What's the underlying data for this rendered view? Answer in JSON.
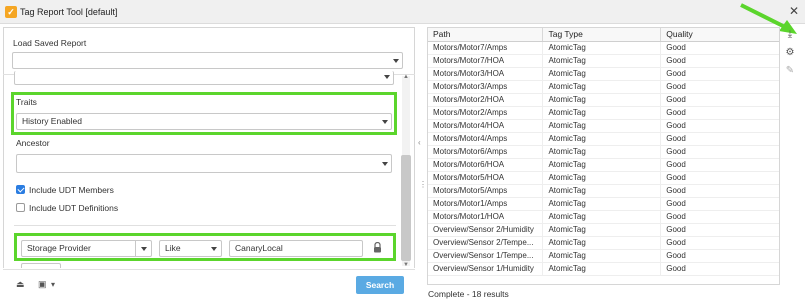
{
  "window": {
    "title": "Tag Report Tool [default]",
    "icon": "check-icon",
    "close": "✕"
  },
  "left": {
    "load_saved_report_label": "Load Saved Report",
    "load_saved_report_value": "",
    "traits_label": "Traits",
    "traits_value": "History Enabled",
    "ancestor_label": "Ancestor",
    "ancestor_value": "",
    "include_udt_members": {
      "label": "Include UDT Members",
      "checked": true
    },
    "include_udt_definitions": {
      "label": "Include UDT Definitions",
      "checked": false
    },
    "filter": {
      "property": "Storage Provider",
      "operator": "Like",
      "value": "CanaryLocal"
    },
    "search_button": "Search"
  },
  "results": {
    "columns": [
      "Path",
      "Tag Type",
      "Quality"
    ],
    "rows": [
      [
        "Motors/Motor7/Amps",
        "AtomicTag",
        "Good"
      ],
      [
        "Motors/Motor7/HOA",
        "AtomicTag",
        "Good"
      ],
      [
        "Motors/Motor3/HOA",
        "AtomicTag",
        "Good"
      ],
      [
        "Motors/Motor3/Amps",
        "AtomicTag",
        "Good"
      ],
      [
        "Motors/Motor2/HOA",
        "AtomicTag",
        "Good"
      ],
      [
        "Motors/Motor2/Amps",
        "AtomicTag",
        "Good"
      ],
      [
        "Motors/Motor4/HOA",
        "AtomicTag",
        "Good"
      ],
      [
        "Motors/Motor4/Amps",
        "AtomicTag",
        "Good"
      ],
      [
        "Motors/Motor6/Amps",
        "AtomicTag",
        "Good"
      ],
      [
        "Motors/Motor6/HOA",
        "AtomicTag",
        "Good"
      ],
      [
        "Motors/Motor5/HOA",
        "AtomicTag",
        "Good"
      ],
      [
        "Motors/Motor5/Amps",
        "AtomicTag",
        "Good"
      ],
      [
        "Motors/Motor1/Amps",
        "AtomicTag",
        "Good"
      ],
      [
        "Motors/Motor1/HOA",
        "AtomicTag",
        "Good"
      ],
      [
        "Overview/Sensor 2/Humidity",
        "AtomicTag",
        "Good"
      ],
      [
        "Overview/Sensor 2/Tempe...",
        "AtomicTag",
        "Good"
      ],
      [
        "Overview/Sensor 1/Tempe...",
        "AtomicTag",
        "Good"
      ],
      [
        "Overview/Sensor 1/Humidity",
        "AtomicTag",
        "Good"
      ]
    ],
    "status": "Complete - 18 results"
  },
  "side_tools": {
    "export_icon": "⤓",
    "settings_icon": "⚙",
    "edit_icon": "✎"
  },
  "bottom_tools": {
    "open_icon": "⏏",
    "save_icon": "▣",
    "more": "▾"
  },
  "colors": {
    "highlight": "#5bd52c",
    "search_button": "#5aaae3",
    "checkbox_on": "#2b7de1"
  }
}
